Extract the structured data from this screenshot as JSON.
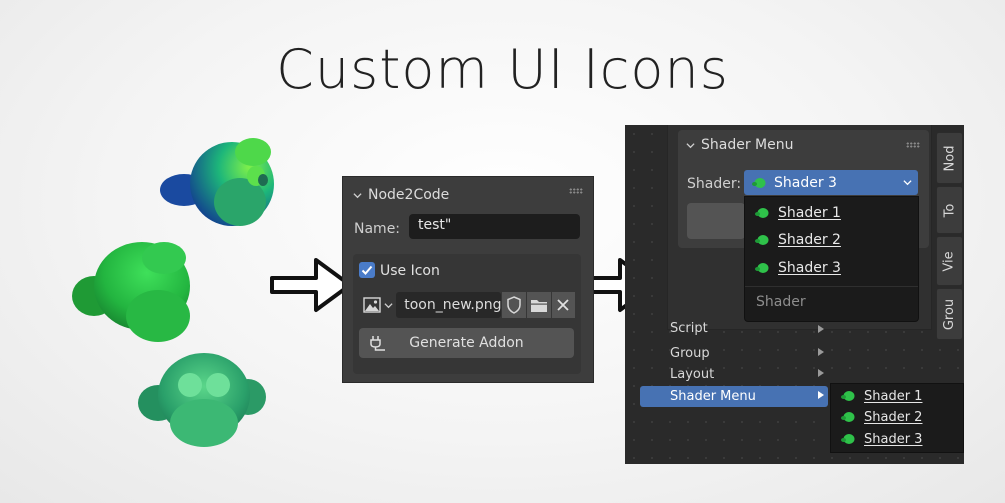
{
  "title": "Custom UI Icons",
  "node2code": {
    "panel_title": "Node2Code",
    "name_label": "Name:",
    "name_value": "test\"",
    "use_icon_label": "Use Icon",
    "use_icon_checked": true,
    "icon_file": "toon_new.png",
    "generate_button": "Generate Addon"
  },
  "shader_panel": {
    "panel_title": "Shader Menu",
    "shader_label": "Shader:",
    "selected": "Shader 3",
    "options": [
      "Shader 1",
      "Shader 2",
      "Shader 3"
    ],
    "footer": "Shader"
  },
  "sidebar_tabs": [
    "Nod",
    "To",
    "Vie",
    "Grou"
  ],
  "context_menu": {
    "items": [
      {
        "label": "Script",
        "active": false
      },
      {
        "label": "Group",
        "active": false
      },
      {
        "label": "Layout",
        "active": false
      },
      {
        "label": "Shader Menu",
        "active": true
      }
    ],
    "submenu": [
      "Shader 1",
      "Shader 2",
      "Shader 3"
    ]
  },
  "colors": {
    "accent": "#4772b3",
    "checkbox": "#4a7cc9",
    "panel": "#3d3d3d",
    "field": "#1d1d1d",
    "monkey_green": "#2fc24a",
    "monkey_blue": "#1b3f8f"
  }
}
